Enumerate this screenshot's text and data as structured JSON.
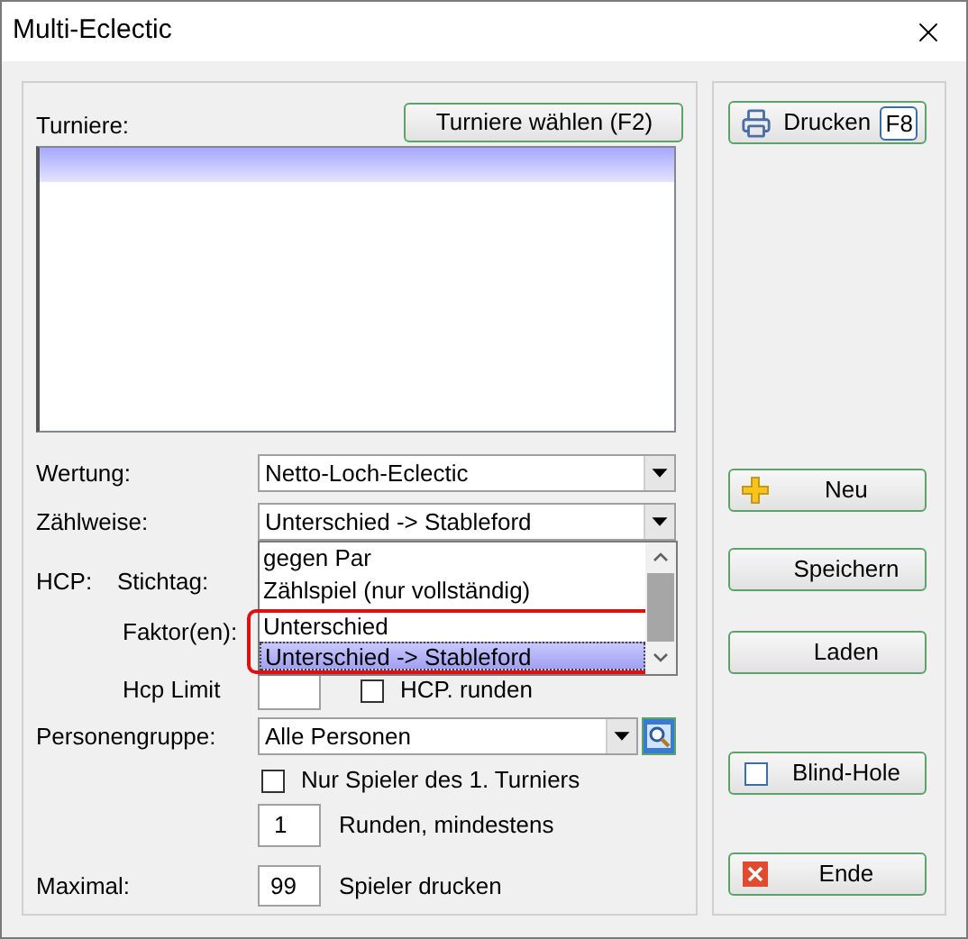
{
  "window": {
    "title": "Multi-Eclectic"
  },
  "tournaments": {
    "label": "Turniere:",
    "button": "Turniere wählen (F2)",
    "rows": [
      {
        "selected": true
      }
    ]
  },
  "wertung": {
    "label": "Wertung:",
    "value": "Netto-Loch-Eclectic"
  },
  "zaehlweise": {
    "label": "Zählweise:",
    "value": "Unterschied -> Stableford",
    "expanded": true,
    "options": [
      {
        "label": "gegen Par",
        "selected": false,
        "highlighted": false
      },
      {
        "label": "Zählspiel (nur vollständig)",
        "selected": false,
        "highlighted": false
      },
      {
        "label": "Unterschied",
        "selected": false,
        "highlighted": true
      },
      {
        "label": "Unterschied -> Stableford",
        "selected": true,
        "highlighted": true
      }
    ]
  },
  "hcp": {
    "label": "HCP:",
    "stichtag_label": "Stichtag:",
    "faktor_label": "Faktor(en):",
    "limit_label": "Hcp Limit",
    "round": {
      "label": "HCP. runden",
      "checked": false
    }
  },
  "personengruppe": {
    "label": "Personengruppe:",
    "value": "Alle Personen"
  },
  "only_first": {
    "label": "Nur Spieler des 1. Turniers",
    "checked": false
  },
  "rounds": {
    "value": "1",
    "label": "Runden, mindestens"
  },
  "maximal": {
    "label": "Maximal:",
    "value": "99",
    "suffix": "Spieler drucken"
  },
  "buttons": [
    {
      "kind": "print",
      "label": "Drucken",
      "shortcut": "F8"
    },
    {
      "kind": "new",
      "label": "Neu"
    },
    {
      "kind": "plain",
      "label": "Speichern"
    },
    {
      "kind": "plain",
      "label": "Laden"
    },
    {
      "kind": "toggle",
      "label": "Blind-Hole",
      "checked": false
    },
    {
      "kind": "exit",
      "label": "Ende"
    }
  ]
}
